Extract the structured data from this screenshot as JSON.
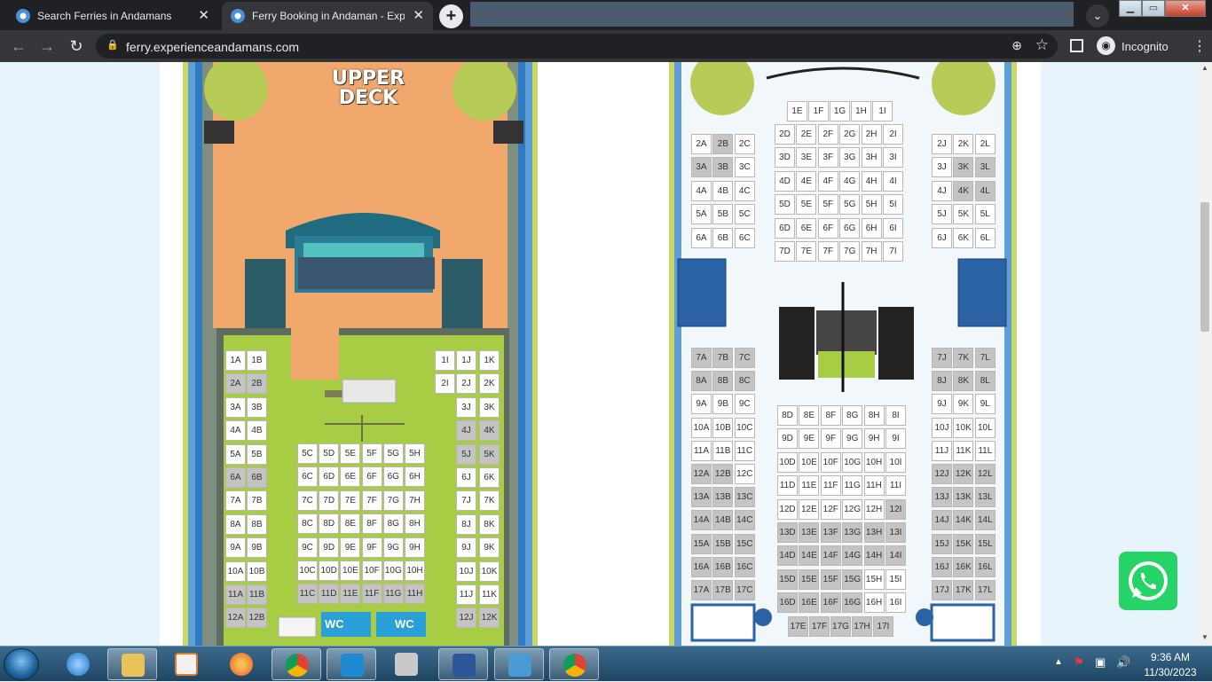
{
  "browser": {
    "tabs": [
      {
        "label": "Search Ferries in Andamans",
        "close": "✕"
      },
      {
        "label": "Ferry Booking in Andaman - Expe",
        "close": "✕"
      }
    ],
    "new_tab": "+",
    "url": "ferry.experienceandamans.com",
    "incognito_label": "Incognito"
  },
  "page": {
    "upper_deck_title_line1": "UPPER",
    "upper_deck_title_line2": "DECK",
    "wc_label": "WC",
    "left_deck_seats": {
      "A_B": [
        [
          "1A",
          "1B"
        ],
        [
          "2A",
          "2B"
        ],
        [
          "3A",
          "3B"
        ],
        [
          "4A",
          "4B"
        ],
        [
          "5A",
          "5B"
        ],
        [
          "6A",
          "6B"
        ],
        [
          "7A",
          "7B"
        ],
        [
          "8A",
          "8B"
        ],
        [
          "9A",
          "9B"
        ],
        [
          "10A",
          "10B"
        ],
        [
          "11A",
          "11B"
        ],
        [
          "12A",
          "12B"
        ]
      ],
      "I_row1": "1I",
      "I_row2": "2I",
      "J_K": [
        [
          "1J",
          "1K"
        ],
        [
          "2J",
          "2K"
        ],
        [
          "3J",
          "3K"
        ],
        [
          "4J",
          "4K"
        ],
        [
          "5J",
          "5K"
        ],
        [
          "6J",
          "6K"
        ],
        [
          "7J",
          "7K"
        ],
        [
          "8J",
          "8K"
        ],
        [
          "9J",
          "9K"
        ],
        [
          "10J",
          "10K"
        ],
        [
          "11J",
          "11K"
        ],
        [
          "12J",
          "12K"
        ]
      ],
      "C_H": [
        [
          "5C",
          "5D",
          "5E",
          "5F",
          "5G",
          "5H"
        ],
        [
          "6C",
          "6D",
          "6E",
          "6F",
          "6G",
          "6H"
        ],
        [
          "7C",
          "7D",
          "7E",
          "7F",
          "7G",
          "7H"
        ],
        [
          "8C",
          "8D",
          "8E",
          "8F",
          "8G",
          "8H"
        ],
        [
          "9C",
          "9D",
          "9E",
          "9F",
          "9G",
          "9H"
        ],
        [
          "10C",
          "10D",
          "10E",
          "10F",
          "10G",
          "10H"
        ],
        [
          "11C",
          "11D",
          "11E",
          "11F",
          "11G",
          "11H"
        ]
      ]
    },
    "right_deck_seats": {
      "top_row": [
        "1E",
        "1F",
        "1G",
        "1H",
        "1I"
      ],
      "D_I_top": [
        [
          "2D",
          "2E",
          "2F",
          "2G",
          "2H",
          "2I"
        ],
        [
          "3D",
          "3E",
          "3F",
          "3G",
          "3H",
          "3I"
        ],
        [
          "4D",
          "4E",
          "4F",
          "4G",
          "4H",
          "4I"
        ],
        [
          "5D",
          "5E",
          "5F",
          "5G",
          "5H",
          "5I"
        ],
        [
          "6D",
          "6E",
          "6F",
          "6G",
          "6H",
          "6I"
        ],
        [
          "7D",
          "7E",
          "7F",
          "7G",
          "7H",
          "7I"
        ]
      ],
      "A_C_top": [
        [
          "2A",
          "2B",
          "2C"
        ],
        [
          "3A",
          "3B",
          "3C"
        ],
        [
          "4A",
          "4B",
          "4C"
        ],
        [
          "5A",
          "5B",
          "5C"
        ],
        [
          "6A",
          "6B",
          "6C"
        ]
      ],
      "J_L_top": [
        [
          "2J",
          "2K",
          "2L"
        ],
        [
          "3J",
          "3K",
          "3L"
        ],
        [
          "4J",
          "4K",
          "4L"
        ],
        [
          "5J",
          "5K",
          "5L"
        ],
        [
          "6J",
          "6K",
          "6L"
        ]
      ],
      "A_C_bottom": [
        [
          "7A",
          "7B",
          "7C"
        ],
        [
          "8A",
          "8B",
          "8C"
        ],
        [
          "9A",
          "9B",
          "9C"
        ],
        [
          "10A",
          "10B",
          "10C"
        ],
        [
          "11A",
          "11B",
          "11C"
        ],
        [
          "12A",
          "12B",
          "12C"
        ],
        [
          "13A",
          "13B",
          "13C"
        ],
        [
          "14A",
          "14B",
          "14C"
        ],
        [
          "15A",
          "15B",
          "15C"
        ],
        [
          "16A",
          "16B",
          "16C"
        ],
        [
          "17A",
          "17B",
          "17C"
        ]
      ],
      "J_L_bottom": [
        [
          "7J",
          "7K",
          "7L"
        ],
        [
          "8J",
          "8K",
          "8L"
        ],
        [
          "9J",
          "9K",
          "9L"
        ],
        [
          "10J",
          "10K",
          "10L"
        ],
        [
          "11J",
          "11K",
          "11L"
        ],
        [
          "12J",
          "12K",
          "12L"
        ],
        [
          "13J",
          "13K",
          "13L"
        ],
        [
          "14J",
          "14K",
          "14L"
        ],
        [
          "15J",
          "15K",
          "15L"
        ],
        [
          "16J",
          "16K",
          "16L"
        ],
        [
          "17J",
          "17K",
          "17L"
        ]
      ],
      "D_I_bottom": [
        [
          "8D",
          "8E",
          "8F",
          "8G",
          "8H",
          "8I"
        ],
        [
          "9D",
          "9E",
          "9F",
          "9G",
          "9H",
          "9I"
        ],
        [
          "10D",
          "10E",
          "10F",
          "10G",
          "10H",
          "10I"
        ],
        [
          "11D",
          "11E",
          "11F",
          "11G",
          "11H",
          "11I"
        ],
        [
          "12D",
          "12E",
          "12F",
          "12G",
          "12H",
          "12I"
        ],
        [
          "13D",
          "13E",
          "13F",
          "13G",
          "13H",
          "13I"
        ],
        [
          "14D",
          "14E",
          "14F",
          "14G",
          "14H",
          "14I"
        ],
        [
          "15D",
          "15E",
          "15F",
          "15G",
          "15H",
          "15I"
        ],
        [
          "16D",
          "16E",
          "16F",
          "16G",
          "16H",
          "16I"
        ]
      ],
      "row17_mid": [
        "17E",
        "17F",
        "17G",
        "17H",
        "17I"
      ]
    },
    "booked_seats": [
      "2A",
      "2B",
      "4J",
      "4K",
      "5J",
      "5K",
      "6A",
      "6B",
      "11A",
      "11B",
      "12A",
      "12B",
      "11C",
      "11D",
      "11E",
      "11F",
      "11G",
      "11H",
      "12J",
      "12K",
      "2B_r",
      "3A_r",
      "3B_r",
      "3K_r",
      "3L_r",
      "4K_r",
      "4L_r",
      "7A_r",
      "7B_r",
      "7C_r",
      "7J_r",
      "7K_r",
      "7L_r",
      "8A_r",
      "8B_r",
      "8C_r",
      "8J_r",
      "8K_r",
      "8L_r",
      "12A_r",
      "12B_r",
      "13A_r",
      "13B_r",
      "13C_r",
      "14A_r",
      "14B_r",
      "14C_r",
      "15A_r",
      "15B_r",
      "15C_r",
      "16A_r",
      "16B_r",
      "16C_r",
      "17A_r",
      "17B_r",
      "17C_r",
      "12J_r",
      "12K_r",
      "12L_r",
      "13J_r",
      "13K_r",
      "13L_r",
      "14J_r",
      "14K_r",
      "14L_r",
      "15J_r",
      "15K_r",
      "15L_r",
      "16J_r",
      "16K_r",
      "16L_r",
      "17J_r",
      "17K_r",
      "17L_r",
      "12I_r",
      "13D_r",
      "13E_r",
      "13F_r",
      "13G_r",
      "13H_r",
      "13I_r",
      "14D_r",
      "14E_r",
      "14F_r",
      "14G_r",
      "14H_r",
      "14I_r",
      "15D_r",
      "15E_r",
      "15F_r",
      "15G_r",
      "16D_r",
      "16E_r",
      "16F_r",
      "16G_r",
      "17E_r",
      "17F_r",
      "17G_r",
      "17H_r",
      "17I_r"
    ]
  },
  "taskbar": {
    "time": "9:36 AM",
    "date": "11/30/2023"
  },
  "colors": {
    "booked": "#c4c4c4",
    "available": "#ffffff",
    "whatsapp": "#25d366",
    "deck_green": "#a8cd45",
    "deck_orange": "#f0a86c"
  }
}
